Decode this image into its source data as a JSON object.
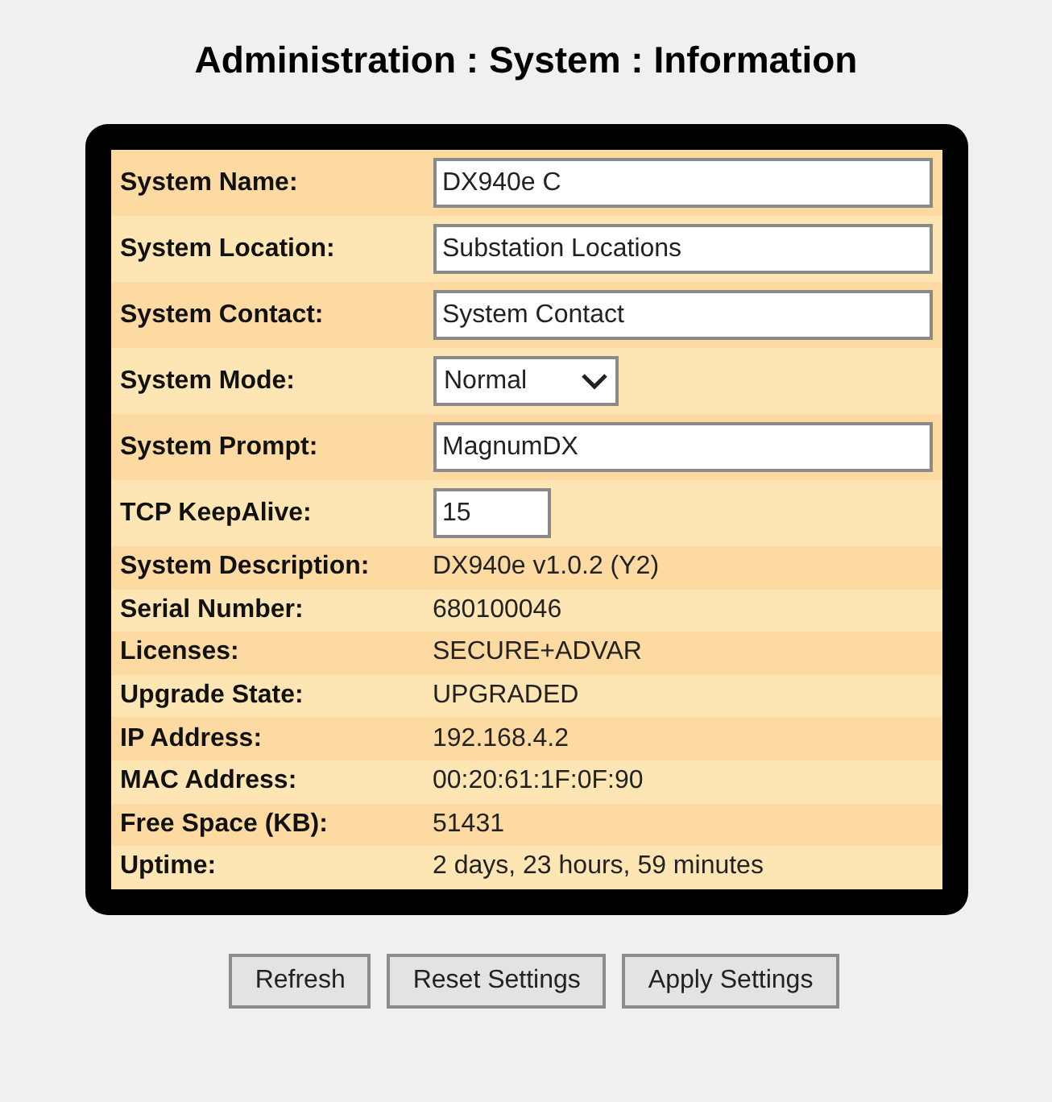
{
  "title": "Administration : System : Information",
  "fields": [
    {
      "label": "System Name:",
      "kind": "text",
      "value": "DX940e C"
    },
    {
      "label": "System Location:",
      "kind": "text",
      "value": "Substation Locations"
    },
    {
      "label": "System Contact:",
      "kind": "text",
      "value": "System Contact"
    },
    {
      "label": "System Mode:",
      "kind": "select",
      "value": "Normal"
    },
    {
      "label": "System Prompt:",
      "kind": "text",
      "value": "MagnumDX"
    },
    {
      "label": "TCP KeepAlive:",
      "kind": "number",
      "value": "15"
    },
    {
      "label": "System Description:",
      "kind": "static",
      "value": "DX940e v1.0.2 (Y2)"
    },
    {
      "label": "Serial Number:",
      "kind": "static",
      "value": "680100046"
    },
    {
      "label": "Licenses:",
      "kind": "static",
      "value": "SECURE+ADVAR"
    },
    {
      "label": "Upgrade State:",
      "kind": "static",
      "value": "UPGRADED"
    },
    {
      "label": "IP Address:",
      "kind": "static",
      "value": "192.168.4.2"
    },
    {
      "label": "MAC Address:",
      "kind": "static",
      "value": "00:20:61:1F:0F:90"
    },
    {
      "label": "Free Space (KB):",
      "kind": "static",
      "value": "51431"
    },
    {
      "label": "Uptime:",
      "kind": "static",
      "value": "2 days, 23 hours, 59 minutes"
    }
  ],
  "buttons": [
    "Refresh",
    "Reset Settings",
    "Apply Settings"
  ]
}
